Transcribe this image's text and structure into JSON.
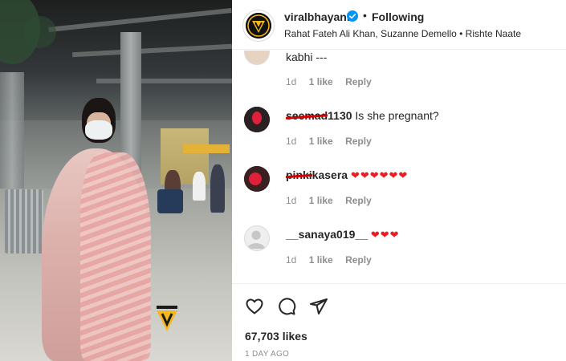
{
  "post": {
    "username": "viralbhayani",
    "separator": "•",
    "follow_status": "Following",
    "audio_line": "Rahat Fateh Ali Khan, Suzanne Demello • Rishte Naate",
    "likes_count": "67,703 likes",
    "timestamp": "1 DAY AGO"
  },
  "comments": [
    {
      "text": "kabhi ---",
      "age": "1d",
      "likes": "1 like",
      "reply": "Reply"
    },
    {
      "username_hidden": "seemad",
      "username_visible": "1130",
      "text": "Is she pregnant?",
      "age": "1d",
      "likes": "1 like",
      "reply": "Reply"
    },
    {
      "username_hidden": "pinki",
      "username_visible": "kasera",
      "text": "❤❤❤❤❤❤",
      "age": "1d",
      "likes": "1 like",
      "reply": "Reply"
    },
    {
      "username": "__sanaya019__",
      "text": "❤❤❤",
      "age": "1d",
      "likes": "1 like",
      "reply": "Reply"
    }
  ],
  "icons": {
    "like": "heart-outline-icon",
    "comment": "comment-bubble-icon",
    "share": "paper-plane-icon",
    "verified": "verified-badge-icon"
  },
  "colors": {
    "verified_blue": "#0095f6",
    "heart_red": "#ed1c24",
    "redaction_red": "#d40000",
    "brand_yellow": "#f5b81c"
  }
}
